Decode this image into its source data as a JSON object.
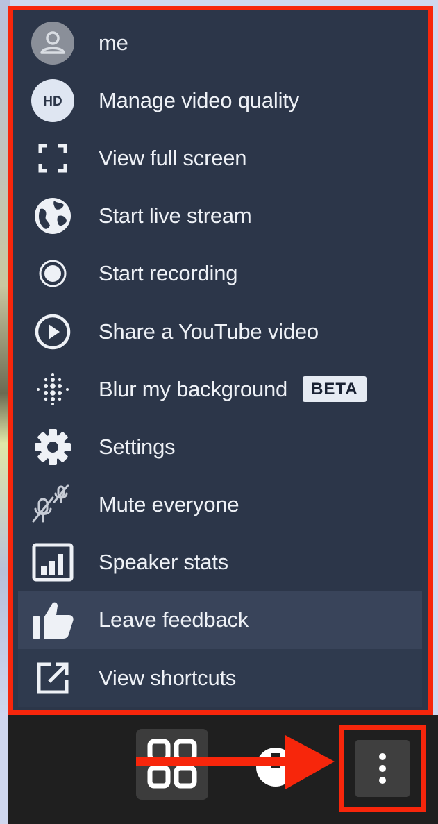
{
  "menu": {
    "items": [
      {
        "label": "me",
        "icon": "avatar-icon"
      },
      {
        "label": "Manage video quality",
        "icon": "hd-icon",
        "icon_text": "HD"
      },
      {
        "label": "View full screen",
        "icon": "fullscreen-icon"
      },
      {
        "label": "Start live stream",
        "icon": "globe-icon"
      },
      {
        "label": "Start recording",
        "icon": "record-icon"
      },
      {
        "label": "Share a YouTube video",
        "icon": "play-circle-icon"
      },
      {
        "label": "Blur my background",
        "icon": "blur-dots-icon",
        "badge": "BETA"
      },
      {
        "label": "Settings",
        "icon": "gear-icon"
      },
      {
        "label": "Mute everyone",
        "icon": "mic-muted-icon"
      },
      {
        "label": "Speaker stats",
        "icon": "bar-chart-icon"
      },
      {
        "label": "Leave feedback",
        "icon": "thumbs-up-icon"
      },
      {
        "label": "View shortcuts",
        "icon": "external-link-icon"
      }
    ]
  },
  "toolbar": {
    "buttons": [
      {
        "icon": "tile-view-icon"
      },
      {
        "icon": "partially-hidden-icon"
      },
      {
        "icon": "more-vertical-icon"
      }
    ]
  },
  "colors": {
    "menu_bg": "#2c3649",
    "highlight": "#f7260b",
    "toolbar_bg": "#1f1f1f",
    "text": "#eef1f6"
  }
}
